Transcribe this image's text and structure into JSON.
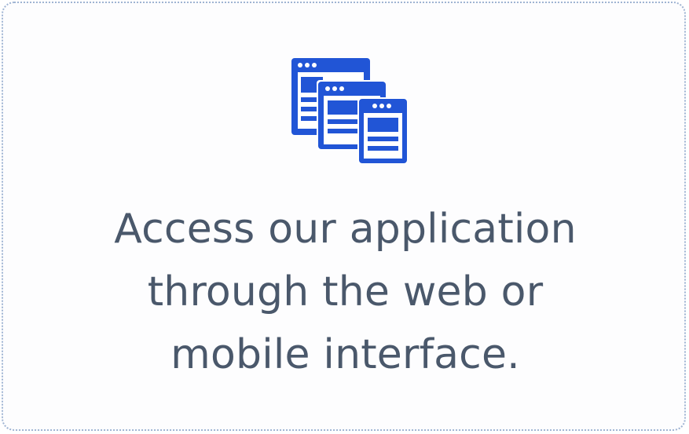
{
  "card": {
    "icon": "multiple-browser-windows-icon",
    "accent_color": "#2155d6",
    "text_color": "#4a586b",
    "caption_lines": [
      "Access our application",
      "through the web or",
      "mobile interface."
    ]
  }
}
